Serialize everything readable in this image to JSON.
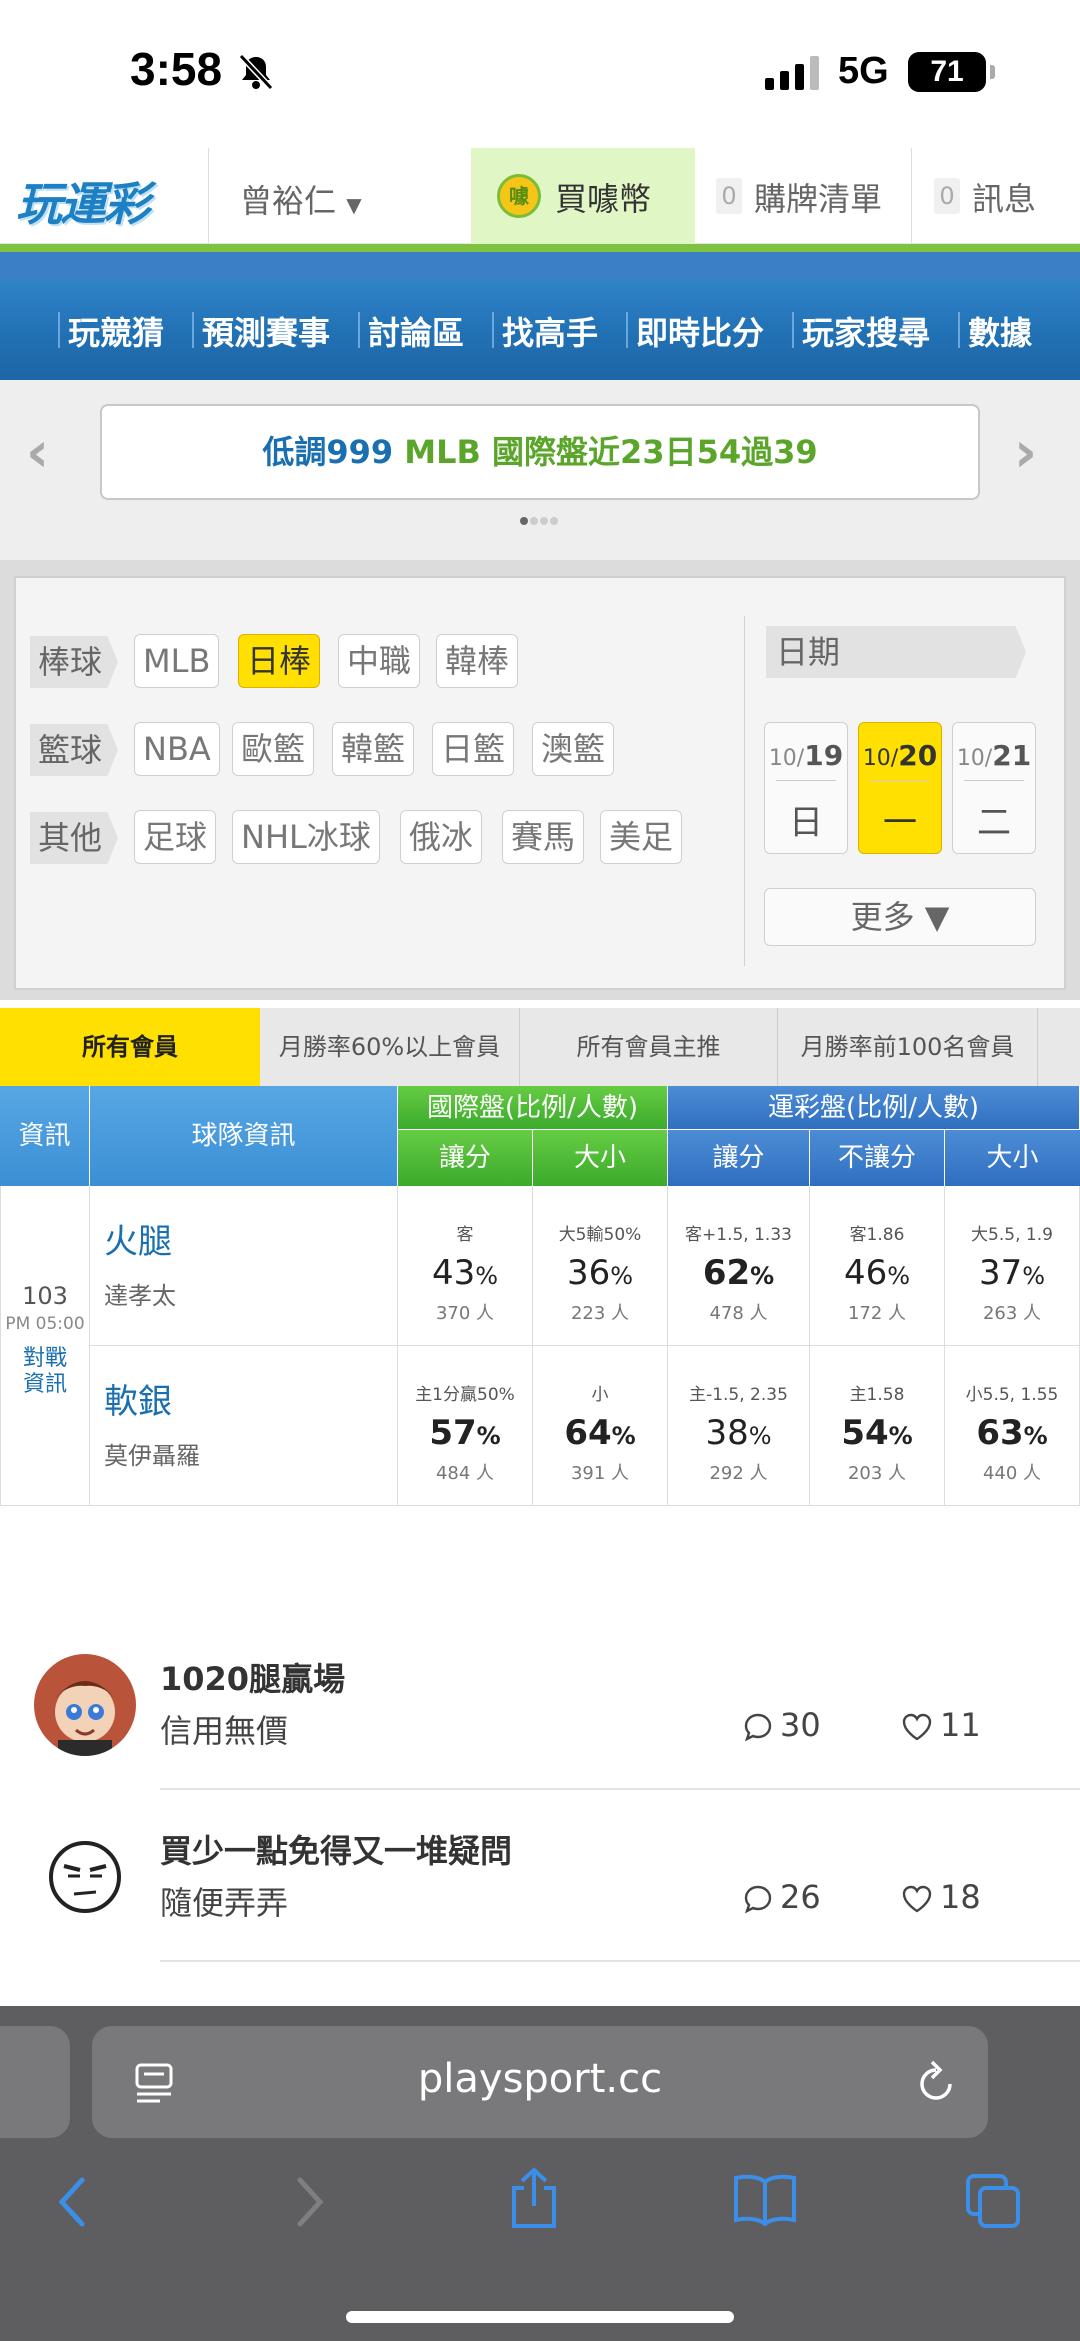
{
  "status_bar": {
    "time": "3:58",
    "network": "5G",
    "battery": "71"
  },
  "header": {
    "logo": "玩運彩",
    "user": "曾裕仁",
    "buy_button": "買噱幣",
    "buy_coin_glyph": "噱",
    "cart_count": "0",
    "cart_label": "購牌清單",
    "msg_count": "0",
    "msg_label": "訊息"
  },
  "nav": [
    "玩競猜",
    "預測賽事",
    "討論區",
    "找高手",
    "即時比分",
    "玩家搜尋",
    "數據"
  ],
  "banner": {
    "text_part1": "低調999",
    "text_part2": "MLB 國際盤近23日54過39"
  },
  "filter": {
    "rows": [
      {
        "category": "棒球",
        "chips": [
          "MLB",
          "日棒",
          "中職",
          "韓棒"
        ],
        "active": "日棒"
      },
      {
        "category": "籃球",
        "chips": [
          "NBA",
          "歐籃",
          "韓籃",
          "日籃",
          "澳籃"
        ]
      },
      {
        "category": "其他",
        "chips": [
          "足球",
          "NHL冰球",
          "俄冰",
          "賽馬",
          "美足"
        ]
      }
    ],
    "date_header": "日期",
    "dates": [
      {
        "month": "10/",
        "day": "19",
        "weekday": "日"
      },
      {
        "month": "10/",
        "day": "20",
        "weekday": "一",
        "active": true
      },
      {
        "month": "10/",
        "day": "21",
        "weekday": "二"
      }
    ],
    "more": "更多 ▼"
  },
  "tabs": [
    "所有會員",
    "月勝率60%以上會員",
    "所有會員主推",
    "月勝率前100名會員"
  ],
  "table": {
    "h_info": "資訊",
    "h_team": "球隊資訊",
    "h_intl": "國際盤(比例/人數)",
    "h_lottery": "運彩盤(比例/人數)",
    "sub": [
      "讓分",
      "大小",
      "讓分",
      "不讓分",
      "大小"
    ],
    "game_no": "103",
    "game_time": "PM 05:00",
    "matchup_link": "對戰資訊",
    "teams": [
      {
        "name": "火腿",
        "pitcher": "達孝太",
        "cells": [
          {
            "top": "客",
            "pct": "43",
            "ppl": "370 人",
            "bold": false
          },
          {
            "top": "大5輸50%",
            "pct": "36",
            "ppl": "223 人",
            "bold": false
          },
          {
            "top": "客+1.5, 1.33",
            "pct": "62",
            "ppl": "478 人",
            "bold": true
          },
          {
            "top": "客1.86",
            "pct": "46",
            "ppl": "172 人",
            "bold": false
          },
          {
            "top": "大5.5, 1.9",
            "pct": "37",
            "ppl": "263 人",
            "bold": false
          }
        ]
      },
      {
        "name": "軟銀",
        "pitcher": "莫伊聶羅",
        "cells": [
          {
            "top": "主1分贏50%",
            "pct": "57",
            "ppl": "484 人",
            "bold": true
          },
          {
            "top": "小",
            "pct": "64",
            "ppl": "391 人",
            "bold": true
          },
          {
            "top": "主-1.5, 2.35",
            "pct": "38",
            "ppl": "292 人",
            "bold": false
          },
          {
            "top": "主1.58",
            "pct": "54",
            "ppl": "203 人",
            "bold": true
          },
          {
            "top": "小5.5, 1.55",
            "pct": "63",
            "ppl": "440 人",
            "bold": true
          }
        ]
      }
    ],
    "pct_unit": "%"
  },
  "posts": [
    {
      "title": "1020腿贏場",
      "subtitle": "信用無價",
      "comments": "30",
      "likes": "11"
    },
    {
      "title": "買少一點免得又一堆疑問",
      "subtitle": "隨便弄弄",
      "comments": "26",
      "likes": "18"
    }
  ],
  "browser": {
    "url": "playsport.cc"
  }
}
